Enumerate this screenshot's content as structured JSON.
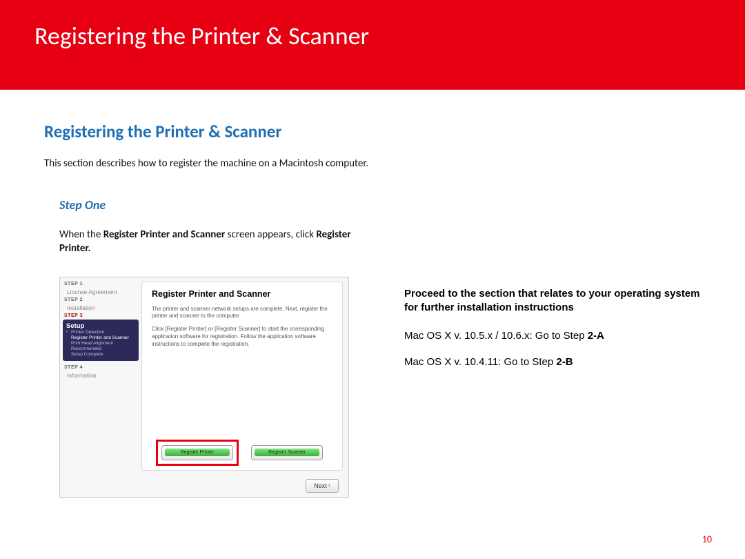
{
  "banner": {
    "title": "Registering the Printer & Scanner"
  },
  "subheading": "Registering the  Printer & Scanner",
  "intro": "This section describes how to register the machine on a Macintosh computer.",
  "step": {
    "label": "Step One",
    "instruction": {
      "prefix": "When the ",
      "bold1": "Register Printer and Scanner",
      "mid": " screen appears, click ",
      "bold2": "Register Printer."
    }
  },
  "installer": {
    "sidebar": {
      "s1": "STEP 1",
      "s1item": "License Agreement",
      "s2": "STEP 2",
      "s2item": "Installation",
      "s3": "STEP 3",
      "setup": "Setup",
      "sub": {
        "a": "Printer Detection",
        "b": "Register Printer and Scanner",
        "c": "Print Head Alignment Recommended",
        "d": "Setup Complete"
      },
      "s4": "STEP 4",
      "s4item": "Information"
    },
    "panel": {
      "title": "Register Printer and Scanner",
      "p1": "The printer and scanner network setups are complete. Next, register the printer and scanner to the computer.",
      "p2": "Click [Register Printer] or [Register Scanner] to start the corresponding application software for registration. Follow the application software instructions to complete the registration."
    },
    "buttons": {
      "register_printer": "Register Printer",
      "register_scanner": "Register Scanner",
      "next": "Next"
    }
  },
  "right": {
    "lead": "Proceed to the section that relates to your operating system for further installation instructions",
    "os1_prefix": "Mac OS X v. 10.5.x / 10.6.x: Go to Step ",
    "os1_bold": "2-A",
    "os2_prefix": "Mac OS X v. 10.4.11: Go to Step ",
    "os2_bold": "2-B"
  },
  "page_number": "10"
}
